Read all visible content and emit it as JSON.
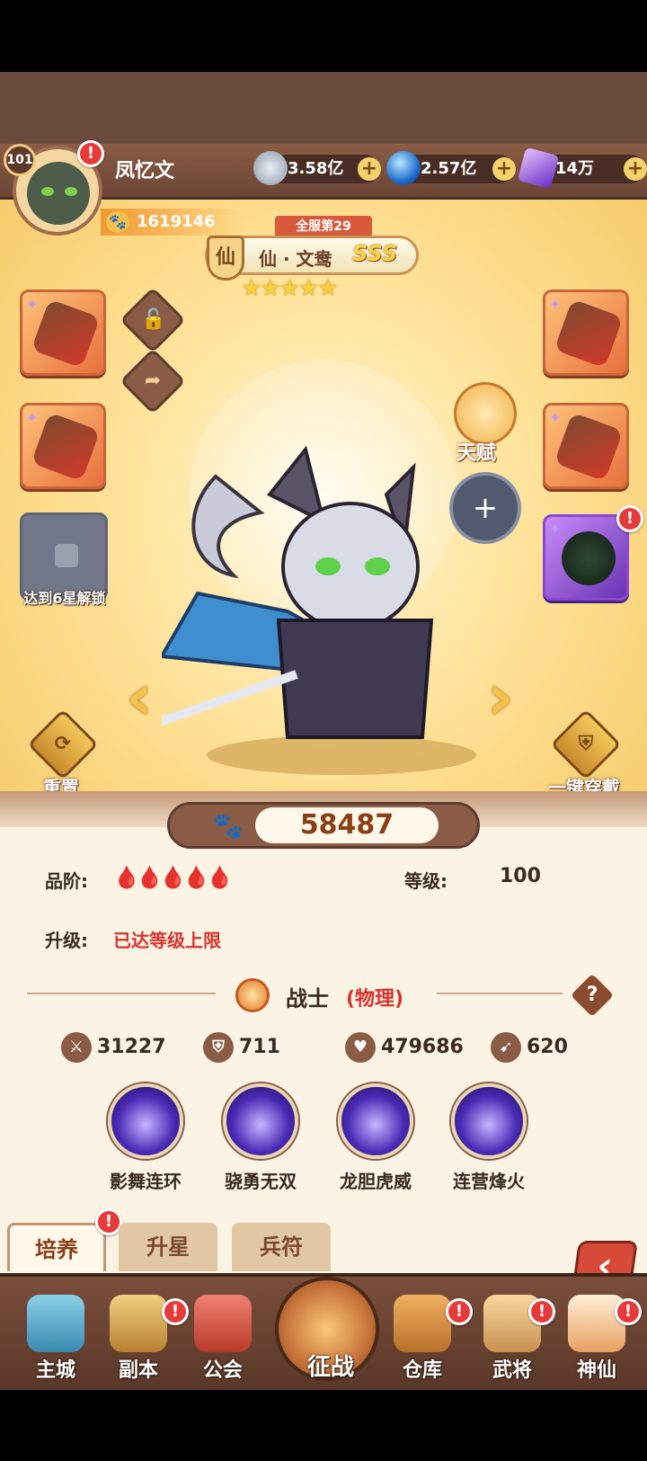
{
  "player": {
    "level": "101",
    "name": "凤忆文",
    "power": "1619146"
  },
  "resources": [
    {
      "icon": "coin-icon",
      "value": "3.58亿"
    },
    {
      "icon": "blue-orb-icon",
      "value": "2.57亿"
    },
    {
      "icon": "purple-crystal-icon",
      "value": "14万"
    }
  ],
  "hero": {
    "server_rank": "全服第29",
    "rank_char": "仙",
    "title": "仙 · 文鸯",
    "grade": "SSS",
    "stars": "★★★★★",
    "combat_power": "58487",
    "quality_label": "品阶:",
    "quality_drops": "🩸🩸🩸🩸🩸",
    "level_label": "等级:",
    "level_value": "100",
    "upgrade_label": "升级:",
    "upgrade_value": "已达等级上限",
    "class_name": "战士",
    "class_sub": "(物理)"
  },
  "actions": {
    "locked_slot": "达到6星解锁",
    "talent": "天赋",
    "reset": "重置",
    "equip_all": "一键穿戴",
    "help": "?"
  },
  "stats": [
    {
      "icon": "sword-icon",
      "value": "31227"
    },
    {
      "icon": "shield-icon",
      "value": "711"
    },
    {
      "icon": "heart-icon",
      "value": "479686"
    },
    {
      "icon": "boot-icon",
      "value": "620"
    }
  ],
  "skills": [
    {
      "name": "影舞连环"
    },
    {
      "name": "骁勇无双"
    },
    {
      "name": "龙胆虎威"
    },
    {
      "name": "连营烽火"
    }
  ],
  "tabs": [
    {
      "label": "培养",
      "active": true
    },
    {
      "label": "升星"
    },
    {
      "label": "兵符"
    }
  ],
  "nav": [
    {
      "label": "主城"
    },
    {
      "label": "副本"
    },
    {
      "label": "公会"
    },
    {
      "label": "征战"
    },
    {
      "label": "仓库"
    },
    {
      "label": "武将"
    },
    {
      "label": "神仙"
    }
  ],
  "alert_mark": "!",
  "colors": {
    "accent": "#f7c24a",
    "panel": "#fbf3e4",
    "alert": "#e73a3a",
    "red_text": "#d6342b"
  }
}
